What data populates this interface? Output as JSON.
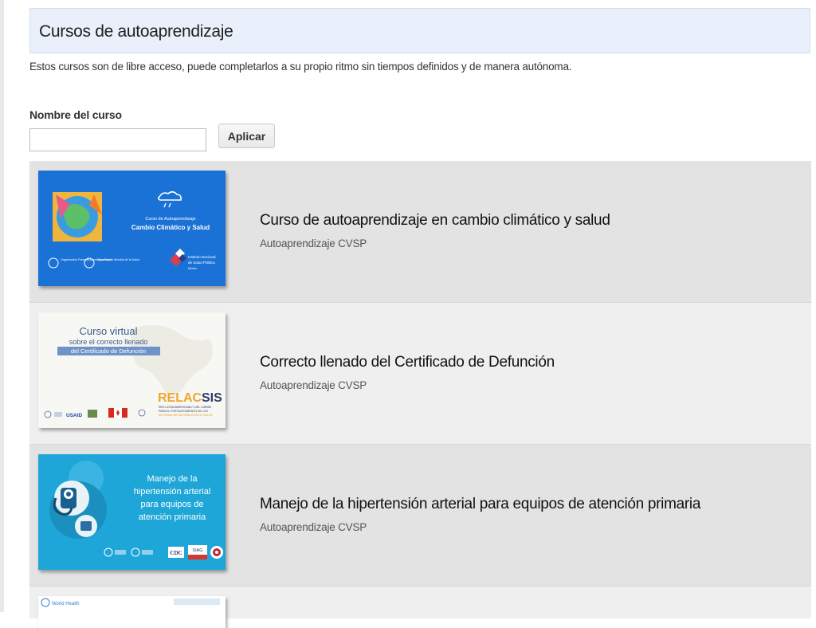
{
  "page": {
    "title": "Cursos de autoaprendizaje",
    "intro": "Estos cursos son de libre acceso, puede completarlos a su propio ritmo sin tiempos definidos y de manera autónoma."
  },
  "filter": {
    "label": "Nombre del curso",
    "value": "",
    "placeholder": "",
    "button_label": "Aplicar"
  },
  "courses": [
    {
      "title": "Curso de autoaprendizaje en cambio climático y salud",
      "subtitle": "Autoaprendizaje CVSP",
      "thumb": {
        "line1": "Curso de Autoaprendizaje",
        "line2": "Cambio Climático y Salud",
        "org1": "Organización Panamericana de la Salud",
        "org2": "Organización Mundial de la Salud",
        "inst1": "Instituto Nacional",
        "inst2": "de Salud Pública",
        "inst3": "México",
        "bg_color": "#1a72d6"
      }
    },
    {
      "title": "Correcto llenado del Certificado de Defunción",
      "subtitle": "Autoaprendizaje CVSP",
      "thumb": {
        "line1": "Curso virtual",
        "line2": "sobre el correcto llenado",
        "line3": "del Certificado de Defunción",
        "brand_a": "RELAC",
        "brand_b": "SIS",
        "brand_sub1": "RED LATINOAMERICANA Y DEL CARIBE",
        "brand_sub2": "PARA EL FORTALECIMIENTO DE LOS",
        "brand_sub3": "SISTEMAS DE INFORMACIÓN DE SALUD",
        "usaid": "USAID"
      }
    },
    {
      "title": "Manejo de la hipertensión arterial para equipos de atención primaria",
      "subtitle": "Autoaprendizaje CVSP",
      "thumb": {
        "line1": "Manejo de la",
        "line2": "hipertensión arterial",
        "line3": "para equipos de",
        "line4": "atención primaria",
        "cdc": "CDC",
        "siag": "SIAG",
        "bg_color": "#1fa6d8"
      }
    },
    {
      "thumb": {
        "org": "World Health"
      }
    }
  ]
}
